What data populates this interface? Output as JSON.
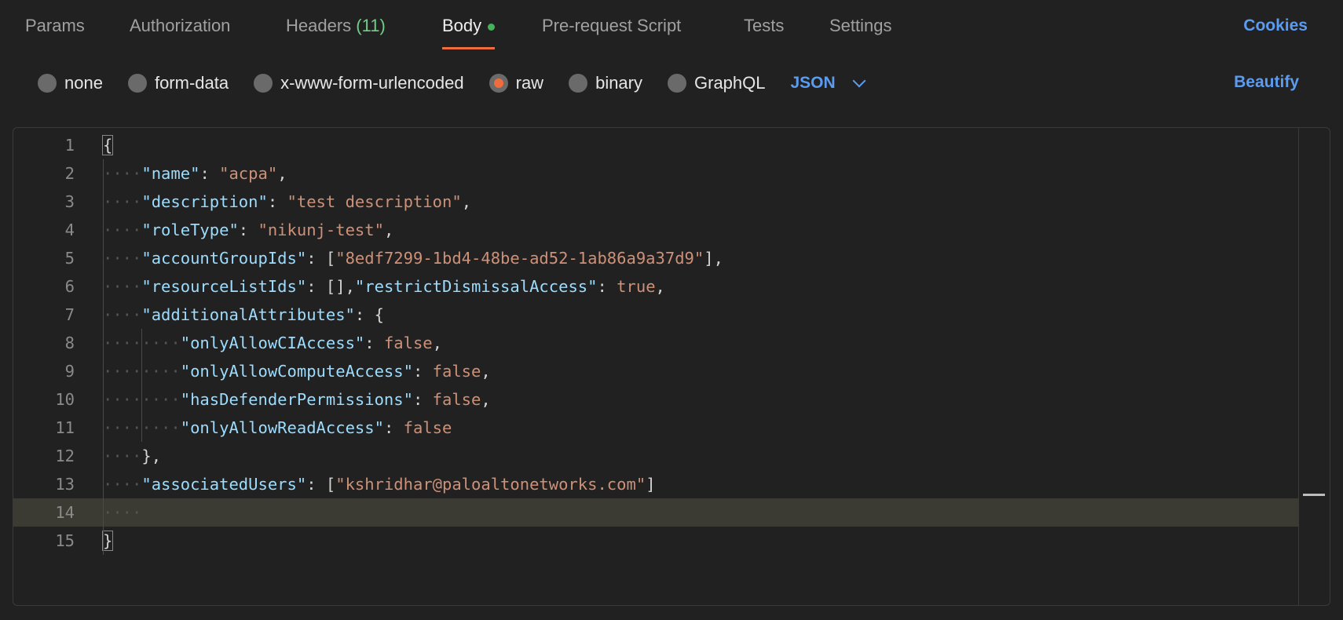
{
  "tabs": {
    "params": "Params",
    "authorization": "Authorization",
    "headers": "Headers",
    "headers_count": "(11)",
    "body": "Body",
    "prerequest": "Pre-request Script",
    "tests": "Tests",
    "settings": "Settings",
    "cookies": "Cookies"
  },
  "body_types": {
    "none": "none",
    "form_data": "form-data",
    "urlencoded": "x-www-form-urlencoded",
    "raw": "raw",
    "binary": "binary",
    "graphql": "GraphQL",
    "selected": "raw",
    "format": "JSON",
    "beautify": "Beautify"
  },
  "editor": {
    "line_numbers": [
      "1",
      "2",
      "3",
      "4",
      "5",
      "6",
      "7",
      "8",
      "9",
      "10",
      "11",
      "12",
      "13",
      "14",
      "15"
    ],
    "current_line": 14,
    "lines": [
      [
        {
          "t": "p",
          "v": "{"
        }
      ],
      [
        {
          "t": "k",
          "v": "\"name\""
        },
        {
          "t": "p",
          "v": ": "
        },
        {
          "t": "s",
          "v": "\"acpa\""
        },
        {
          "t": "p",
          "v": ","
        }
      ],
      [
        {
          "t": "k",
          "v": "\"description\""
        },
        {
          "t": "p",
          "v": ": "
        },
        {
          "t": "s",
          "v": "\"test description\""
        },
        {
          "t": "p",
          "v": ","
        }
      ],
      [
        {
          "t": "k",
          "v": "\"roleType\""
        },
        {
          "t": "p",
          "v": ": "
        },
        {
          "t": "s",
          "v": "\"nikunj-test\""
        },
        {
          "t": "p",
          "v": ","
        }
      ],
      [
        {
          "t": "k",
          "v": "\"accountGroupIds\""
        },
        {
          "t": "p",
          "v": ": ["
        },
        {
          "t": "s",
          "v": "\"8edf7299-1bd4-48be-ad52-1ab86a9a37d9\""
        },
        {
          "t": "p",
          "v": "],"
        }
      ],
      [
        {
          "t": "k",
          "v": "\"resourceListIds\""
        },
        {
          "t": "p",
          "v": ": [],"
        },
        {
          "t": "k",
          "v": "\"restrictDismissalAccess\""
        },
        {
          "t": "p",
          "v": ": "
        },
        {
          "t": "s",
          "v": "true"
        },
        {
          "t": "p",
          "v": ","
        }
      ],
      [
        {
          "t": "k",
          "v": "\"additionalAttributes\""
        },
        {
          "t": "p",
          "v": ": {"
        }
      ],
      [
        {
          "t": "k",
          "v": "\"onlyAllowCIAccess\""
        },
        {
          "t": "p",
          "v": ": "
        },
        {
          "t": "s",
          "v": "false"
        },
        {
          "t": "p",
          "v": ","
        }
      ],
      [
        {
          "t": "k",
          "v": "\"onlyAllowComputeAccess\""
        },
        {
          "t": "p",
          "v": ": "
        },
        {
          "t": "s",
          "v": "false"
        },
        {
          "t": "p",
          "v": ","
        }
      ],
      [
        {
          "t": "k",
          "v": "\"hasDefenderPermissions\""
        },
        {
          "t": "p",
          "v": ": "
        },
        {
          "t": "s",
          "v": "false"
        },
        {
          "t": "p",
          "v": ","
        }
      ],
      [
        {
          "t": "k",
          "v": "\"onlyAllowReadAccess\""
        },
        {
          "t": "p",
          "v": ": "
        },
        {
          "t": "s",
          "v": "false"
        }
      ],
      [
        {
          "t": "p",
          "v": "},"
        }
      ],
      [
        {
          "t": "k",
          "v": "\"associatedUsers\""
        },
        {
          "t": "p",
          "v": ": ["
        },
        {
          "t": "s",
          "v": "\"kshridhar@paloaltonetworks.com\""
        },
        {
          "t": "p",
          "v": "]"
        }
      ],
      [],
      [
        {
          "t": "p",
          "v": "}"
        }
      ]
    ],
    "indents": [
      0,
      4,
      4,
      4,
      4,
      4,
      4,
      8,
      8,
      8,
      8,
      4,
      4,
      4,
      0
    ]
  }
}
